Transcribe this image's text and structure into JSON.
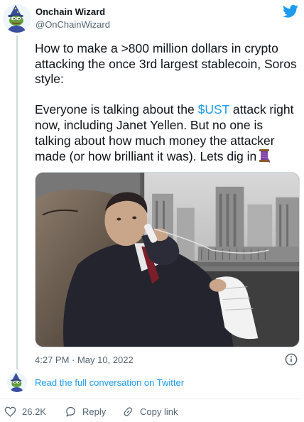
{
  "tweet": {
    "author": {
      "name": "Onchain Wizard",
      "handle": "@OnChainWizard"
    },
    "text": {
      "para1": "How to make a >800 million dollars in crypto attacking the once 3rd largest stablecoin, Soros style:",
      "para2_before": "Everyone is talking about the ",
      "mention": "$UST",
      "para2_after": " attack right now, including Janet Yellen. But no one is talking about how much money the attacker made (or how brilliant it was). Lets dig in"
    },
    "timestamp": "4:27 PM · May 10, 2022",
    "full_conversation_link": "Read the full conversation on Twitter",
    "actions": {
      "likes": "26.2K",
      "reply_label": "Reply",
      "copy_label": "Copy link"
    }
  },
  "icons": {
    "brand": "twitter-bird-icon",
    "info": "info-icon",
    "like": "heart-icon",
    "reply": "speech-bubble-icon",
    "copy": "link-icon",
    "emoji": "thread-spool-icon"
  },
  "colors": {
    "accent": "#1d9bf0",
    "text": "#0f1419",
    "muted": "#536471",
    "line": "#cfd9de"
  }
}
